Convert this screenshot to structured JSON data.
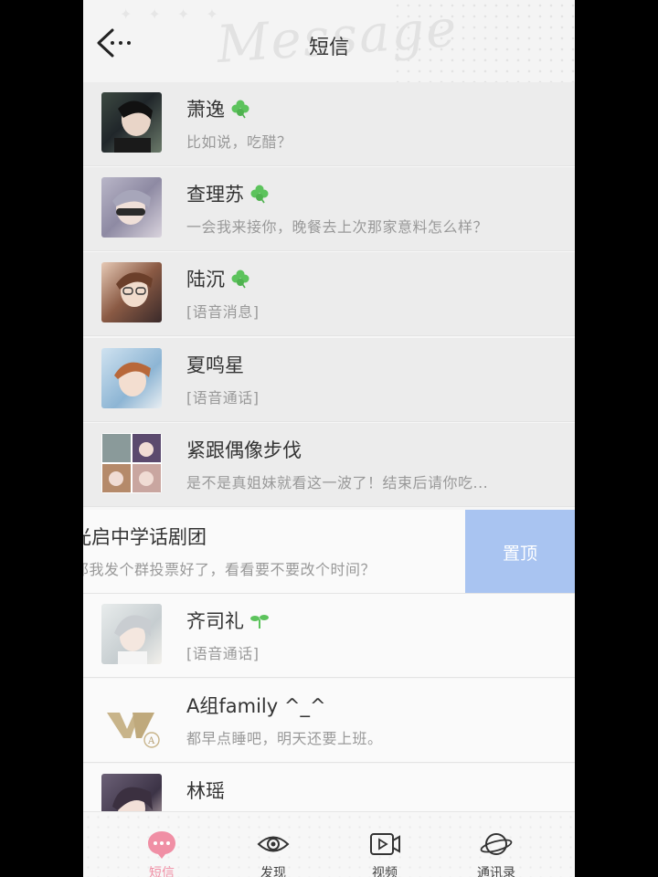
{
  "header": {
    "title": "短信",
    "watermark": "Message"
  },
  "conversations": [
    {
      "name": "萧逸",
      "message": "比如说，吃醋？",
      "badge": "clover"
    },
    {
      "name": "查理苏",
      "message": "一会我来接你，晚餐去上次那家意料怎么样？",
      "badge": "clover"
    },
    {
      "name": "陆沉",
      "message": "[语音消息]",
      "badge": "clover"
    },
    {
      "name": "夏鸣星",
      "message": "[语音通话]",
      "badge": ""
    },
    {
      "name": "紧跟偶像步伐",
      "message": "是不是真姐妹就看这一波了！结束后请你吃...",
      "badge": ""
    },
    {
      "name": "光启中学话剧团",
      "message": "那我发个群投票好了，看看要不要改个时间？",
      "badge": ""
    },
    {
      "name": "齐司礼",
      "message": "[语音通话]",
      "badge": "sprout"
    },
    {
      "name": "A组family ^_^",
      "message": "都早点睡吧，明天还要上班。",
      "badge": ""
    },
    {
      "name": "林瑶",
      "message": "",
      "badge": ""
    }
  ],
  "swipe_action": {
    "label": "置顶"
  },
  "nav": [
    {
      "label": "短信",
      "icon": "chat-bubble-icon",
      "active": true
    },
    {
      "label": "发现",
      "icon": "eye-icon",
      "active": false
    },
    {
      "label": "视频",
      "icon": "video-icon",
      "active": false
    },
    {
      "label": "通讯录",
      "icon": "planet-icon",
      "active": false
    }
  ],
  "colors": {
    "accent_pink": "#f08fa5",
    "pin_blue": "#a9c4f1",
    "clover_green": "#5cc35c"
  }
}
